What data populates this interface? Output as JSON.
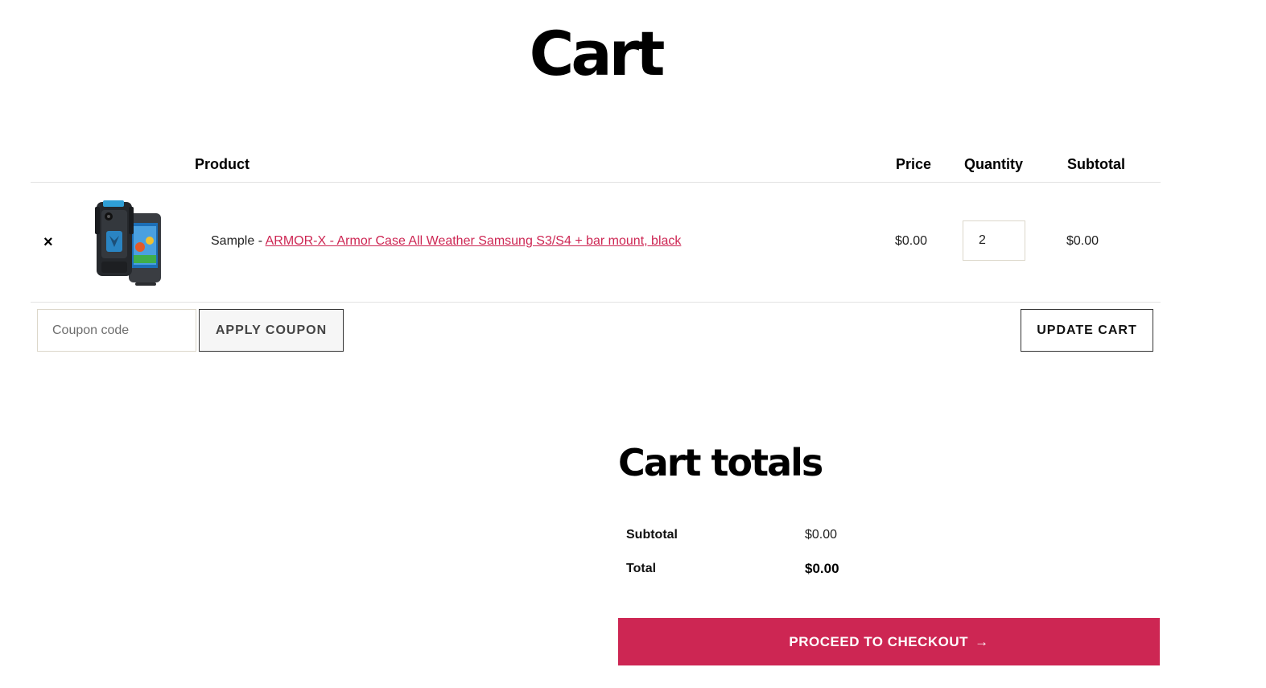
{
  "page": {
    "title": "Cart"
  },
  "table": {
    "headers": {
      "product": "Product",
      "price": "Price",
      "quantity": "Quantity",
      "subtotal": "Subtotal"
    },
    "items": [
      {
        "remove_symbol": "×",
        "image_icon": "phone-case-product-icon",
        "name_prefix": "Sample - ",
        "name_link": "ARMOR-X - Armor Case All Weather Samsung S3/S4 + bar mount, black",
        "price": "$0.00",
        "quantity": "2",
        "subtotal": "$0.00"
      }
    ]
  },
  "coupon": {
    "placeholder": "Coupon code",
    "apply_label": "APPLY COUPON"
  },
  "update_cart_label": "UPDATE CART",
  "totals": {
    "title": "Cart totals",
    "subtotal_label": "Subtotal",
    "subtotal_value": "$0.00",
    "total_label": "Total",
    "total_value": "$0.00"
  },
  "checkout": {
    "label": "PROCEED TO CHECKOUT",
    "arrow": "→"
  },
  "colors": {
    "accent": "#cd2653",
    "border": "#e2e2e2",
    "input_border": "#dcd7ca"
  }
}
